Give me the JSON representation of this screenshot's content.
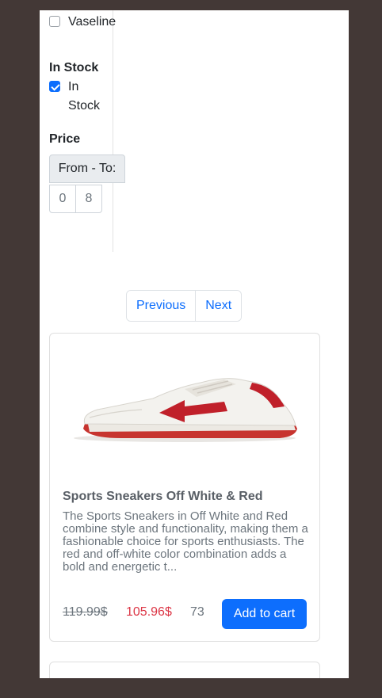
{
  "filters": {
    "brand_option": {
      "label": "Vaseline",
      "checked": false
    },
    "stock_heading": "In Stock",
    "stock_option_line1": "In",
    "stock_option_line2": "Stock",
    "stock_option_checked": true,
    "price_heading": "Price",
    "price_addon": "From - To:",
    "price_from": "0",
    "price_to": "8"
  },
  "pagination": {
    "previous": "Previous",
    "next": "Next"
  },
  "products": [
    {
      "title": "Sports Sneakers Off White & Red",
      "description": "The Sports Sneakers in Off White and Red combine style and functionality, making them a fashionable choice for sports enthusiasts. The red and off-white color combination adds a bold and energetic t...",
      "old_price": "119.99$",
      "new_price": "105.96$",
      "stock": "73",
      "button": "Add to cart",
      "image_icon": "sneaker-image"
    }
  ],
  "colors": {
    "accent": "#0d6efd",
    "sale_price": "#dc3545",
    "background": "#433836",
    "sneaker_red": "#c0202a",
    "sneaker_white": "#f1f0ec"
  }
}
